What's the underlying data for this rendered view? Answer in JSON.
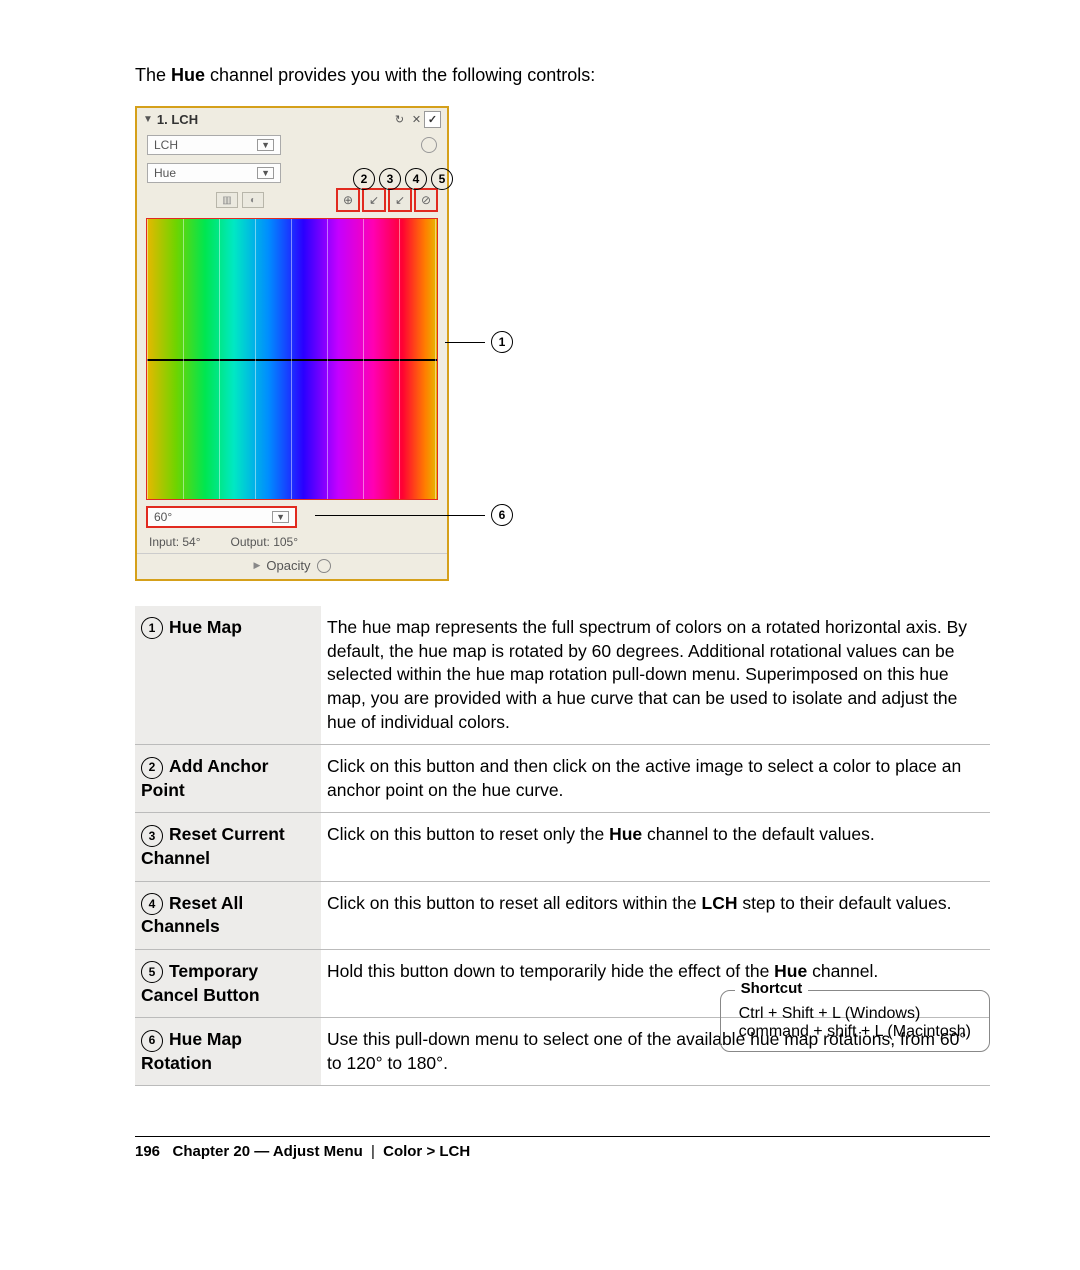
{
  "intro": {
    "pre": "The ",
    "bold": "Hue",
    "post": " channel provides you with the following controls:"
  },
  "panel": {
    "title": "1. LCH",
    "mode": "LCH",
    "channel": "Hue",
    "rotation_value": "60°",
    "input_label": "Input: 54°",
    "output_label": "Output: 105°",
    "opacity_label": "Opacity"
  },
  "callouts": {
    "c1": "1",
    "c6": "6",
    "top": [
      "2",
      "3",
      "4",
      "5"
    ]
  },
  "table": [
    {
      "n": "1",
      "label": "Hue Map",
      "desc_pre": "The hue map represents the full spectrum of colors on a rotated horizontal axis. By default, the hue map is rotated by 60 degrees. Additional rotational values can be selected within the hue map rotation pull-down menu. Superimposed on this hue map, you are provided with a hue curve that can be used to isolate and adjust the hue of individual colors."
    },
    {
      "n": "2",
      "label": "Add Anchor Point",
      "desc_pre": "Click on this button and then click on the active image to select a color to place an anchor point on the hue curve."
    },
    {
      "n": "3",
      "label": "Reset Current Channel",
      "desc_pre": "Click on this button to reset only the ",
      "bold": "Hue",
      "desc_post": " channel to the default values."
    },
    {
      "n": "4",
      "label": "Reset All Channels",
      "desc_pre": "Click on this button to reset all editors within the ",
      "bold": "LCH",
      "desc_post": " step to their default values."
    },
    {
      "n": "5",
      "label": "Temporary Cancel Button",
      "desc_pre": "Hold this button down to temporarily hide the effect of the ",
      "bold": "Hue",
      "desc_post": " channel."
    },
    {
      "n": "6",
      "label": "Hue Map Rotation",
      "desc_pre": "Use this pull-down menu to select one of the available hue map rotations, from 60° to 120° to 180°."
    }
  ],
  "shortcut": {
    "title": "Shortcut",
    "win": "Ctrl + Shift + L (Windows)",
    "mac": "command + shift + L (Macintosh)"
  },
  "footer": {
    "page": "196",
    "chapter": "Chapter 20 — Adjust Menu",
    "crumb": "Color > LCH"
  }
}
